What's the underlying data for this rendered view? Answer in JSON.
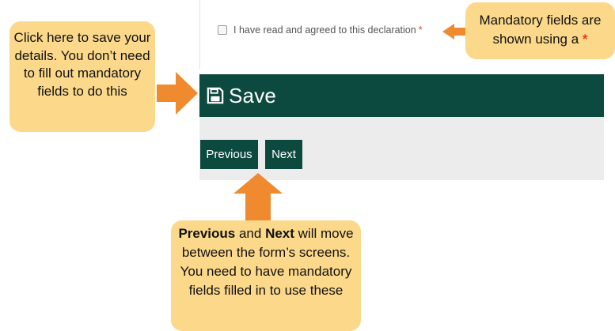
{
  "form": {
    "declaration_text": "I have read and agreed to this declaration",
    "required_marker": "*",
    "save_label": "Save",
    "previous_label": "Previous",
    "next_label": "Next"
  },
  "callouts": {
    "save_note": "Click here to save your details. You don’t need to fill out mandatory fields to do this",
    "mandatory_note": "Mandatory fields are shown using a",
    "mandatory_marker": "*",
    "nav_note_bold_1": "Previous",
    "nav_note_text_1": " and ",
    "nav_note_bold_2": "Next",
    "nav_note_text_2": " will move between the form’s screens. You need to have mandatory fields filled in to use these"
  },
  "colors": {
    "brand_dark_green": "#0c4a3f",
    "callout_yellow": "#fcd88a",
    "arrow_orange": "#ef8a2e",
    "required_red": "#e2401c"
  },
  "icons": {
    "save": "floppy-disk-icon"
  }
}
